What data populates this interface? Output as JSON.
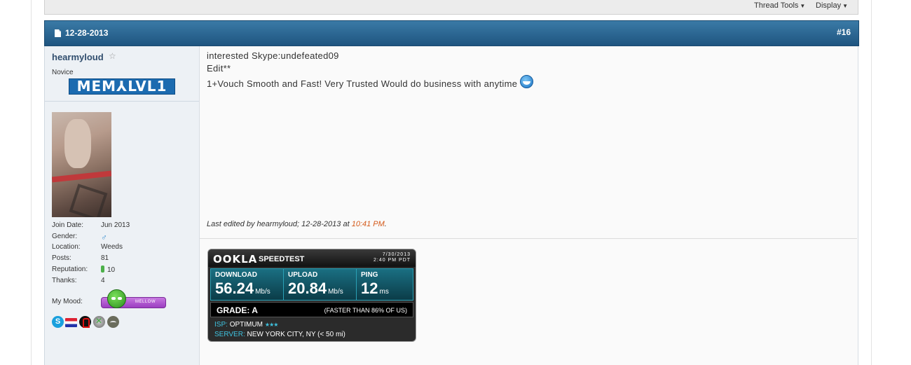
{
  "toolbar": {
    "thread_tools": "Thread Tools",
    "display": "Display"
  },
  "post": {
    "date": "12-28-2013",
    "number": "#16",
    "message_line1": "interested Skype:undefeated09",
    "message_line2": "Edit**",
    "message_line3": "1+Vouch Smooth and Fast! Very Trusted Would do business with anytime",
    "last_edited_prefix": "Last edited by hearmyloud; 12-28-2013 at ",
    "last_edited_time": "10:41 PM",
    "last_edited_suffix": "."
  },
  "user": {
    "name": "hearmyloud",
    "title": "Novice",
    "rank_text": "MEM⅄LVL1",
    "stats": [
      {
        "label": "Join Date:",
        "value": "Jun 2013"
      },
      {
        "label": "Gender:",
        "value": ""
      },
      {
        "label": "Location:",
        "value": "Weeds"
      },
      {
        "label": "Posts:",
        "value": "81"
      },
      {
        "label": "Reputation:",
        "value": "10"
      },
      {
        "label": "Thanks:",
        "value": "4"
      }
    ],
    "mood_label": "My Mood:",
    "mood_value": "MELLOW",
    "skype_letter": "S"
  },
  "speedtest": {
    "logo": "OOKLA",
    "title": "SPEEDTEST",
    "date": "7/30/2013",
    "time": "2:40 PM PDT",
    "download_label": "DOWNLOAD",
    "download_value": "56.24",
    "download_unit": "Mb/s",
    "upload_label": "UPLOAD",
    "upload_value": "20.84",
    "upload_unit": "Mb/s",
    "ping_label": "PING",
    "ping_value": "12",
    "ping_unit": "ms",
    "grade": "GRADE: A",
    "faster": "(FASTER THAN 86% OF US)",
    "isp_label": "ISP:",
    "isp_value": "OPTIMUM",
    "isp_stars": "★★★",
    "server_label": "SERVER:",
    "server_value": "NEW YORK CITY, NY (< 50 mi)"
  },
  "icons": {
    "male": "♂",
    "star": "☆",
    "caret": "▼"
  }
}
